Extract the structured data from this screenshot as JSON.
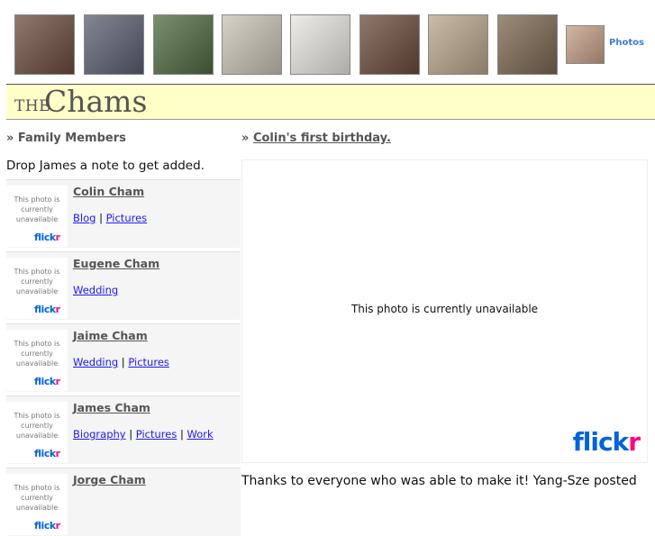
{
  "strip": {
    "thumbs": [
      {
        "name": "family-selfie-photo",
        "color": "#6b4b3e"
      },
      {
        "name": "restaurant-family-photo",
        "color": "#5a5f70"
      },
      {
        "name": "park-trees-photo",
        "color": "#4d6a3f"
      },
      {
        "name": "tent-child-photo",
        "color": "#c9c2b5"
      },
      {
        "name": "child-white-shirt-photo",
        "color": "#e8e6e1"
      },
      {
        "name": "family-selfie-2-photo",
        "color": "#6a4a3a"
      },
      {
        "name": "wood-blocks-tower-photo",
        "color": "#b9a58a"
      },
      {
        "name": "pagoda-model-photo",
        "color": "#7a6650"
      },
      {
        "name": "face-closeup-photo",
        "color": "#c59e85"
      }
    ],
    "photos_label": "Photos"
  },
  "banner": {
    "the": "THE",
    "name": "Chams"
  },
  "left": {
    "heading": "» Family Members",
    "note": "Drop James a note to get added.",
    "unavailable": "This photo is currently unavailable",
    "logo_a": "flick",
    "logo_b": "r",
    "members": [
      {
        "name": "Colin Cham",
        "links": [
          "Blog",
          "Pictures"
        ]
      },
      {
        "name": "Eugene Cham",
        "links": [
          "Wedding"
        ]
      },
      {
        "name": "Jaime Cham",
        "links": [
          "Wedding",
          "Pictures"
        ]
      },
      {
        "name": "James Cham",
        "links": [
          "Biography",
          "Pictures",
          "Work"
        ]
      },
      {
        "name": "Jorge Cham",
        "links": []
      }
    ]
  },
  "right": {
    "heading_prefix": "» ",
    "heading": "Colin's first birthday.",
    "photo_message": "This photo is currently unavailable",
    "logo_a": "flick",
    "logo_b": "r",
    "post_text": "Thanks to everyone who was able to make it! Yang-Sze posted"
  }
}
